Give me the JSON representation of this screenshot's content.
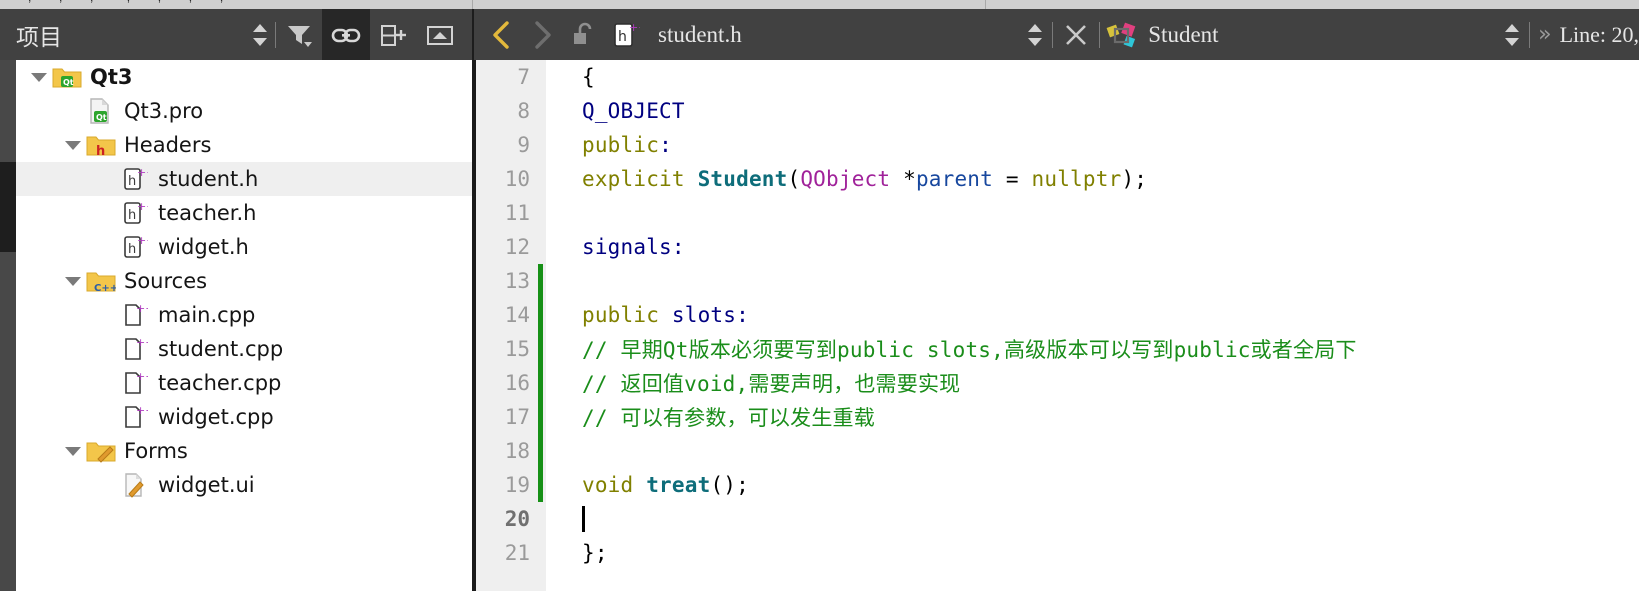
{
  "top_strip": {
    "ghost_text": "\\u25a0, \\u25a0, \\u25a0, \\u25a0, \\u25a0"
  },
  "toolbar": {
    "project_selector_label": "项目",
    "filter_icon": "filter-icon",
    "link_icon": "link-with-editor-icon",
    "split_add_icon": "split-add-icon",
    "collapse_icon": "collapse-icon",
    "back_icon": "navigate-back-icon",
    "forward_icon": "navigate-forward-icon",
    "lock_icon": "unlocked-padlock-icon",
    "file_type_icon": "cpp-header-file-icon",
    "open_file_name": "student.h",
    "close_icon": "close-document-icon",
    "symbol_icon": "qt-class-symbol-icon",
    "symbol_name": "Student",
    "overflow_icon": "overflow-chevrons-icon",
    "cursor_position": "Line: 20,"
  },
  "tree": {
    "items": [
      {
        "label": "Qt3",
        "icon": "qt-project-folder-icon",
        "depth": 0,
        "expanded": true,
        "bold": true,
        "selected": false
      },
      {
        "label": "Qt3.pro",
        "icon": "qt-pro-file-icon",
        "depth": 1,
        "expanded": null,
        "bold": false,
        "selected": false
      },
      {
        "label": "Headers",
        "icon": "headers-folder-icon",
        "depth": 1,
        "expanded": true,
        "bold": false,
        "selected": false
      },
      {
        "label": "student.h",
        "icon": "cpp-header-file-icon",
        "depth": 2,
        "expanded": null,
        "bold": false,
        "selected": true
      },
      {
        "label": "teacher.h",
        "icon": "cpp-header-file-icon",
        "depth": 2,
        "expanded": null,
        "bold": false,
        "selected": false
      },
      {
        "label": "widget.h",
        "icon": "cpp-header-file-icon",
        "depth": 2,
        "expanded": null,
        "bold": false,
        "selected": false
      },
      {
        "label": "Sources",
        "icon": "sources-folder-icon",
        "depth": 1,
        "expanded": true,
        "bold": false,
        "selected": false
      },
      {
        "label": "main.cpp",
        "icon": "cpp-source-file-icon",
        "depth": 2,
        "expanded": null,
        "bold": false,
        "selected": false
      },
      {
        "label": "student.cpp",
        "icon": "cpp-source-file-icon",
        "depth": 2,
        "expanded": null,
        "bold": false,
        "selected": false
      },
      {
        "label": "teacher.cpp",
        "icon": "cpp-source-file-icon",
        "depth": 2,
        "expanded": null,
        "bold": false,
        "selected": false
      },
      {
        "label": "widget.cpp",
        "icon": "cpp-source-file-icon",
        "depth": 2,
        "expanded": null,
        "bold": false,
        "selected": false
      },
      {
        "label": "Forms",
        "icon": "forms-folder-icon",
        "depth": 1,
        "expanded": true,
        "bold": false,
        "selected": false
      },
      {
        "label": "widget.ui",
        "icon": "ui-form-file-icon",
        "depth": 2,
        "expanded": null,
        "bold": false,
        "selected": false
      }
    ]
  },
  "editor": {
    "lines": [
      {
        "no": "7",
        "changed": false,
        "current": false,
        "tokens": [
          {
            "t": "{",
            "c": "plain"
          }
        ]
      },
      {
        "no": "8",
        "changed": false,
        "current": false,
        "tokens": [
          {
            "t": "    ",
            "c": "plain"
          },
          {
            "t": "Q_OBJECT",
            "c": "macro"
          }
        ]
      },
      {
        "no": "9",
        "changed": false,
        "current": false,
        "tokens": [
          {
            "t": "public",
            "c": "kw"
          },
          {
            "t": ":",
            "c": "navy"
          }
        ]
      },
      {
        "no": "10",
        "changed": false,
        "current": false,
        "tokens": [
          {
            "t": "    ",
            "c": "plain"
          },
          {
            "t": "explicit ",
            "c": "kw"
          },
          {
            "t": "Student",
            "c": "type"
          },
          {
            "t": "(",
            "c": "plain"
          },
          {
            "t": "QObject ",
            "c": "cls"
          },
          {
            "t": "*",
            "c": "plain"
          },
          {
            "t": "parent",
            "c": "var"
          },
          {
            "t": " = ",
            "c": "plain"
          },
          {
            "t": "nullptr",
            "c": "kw"
          },
          {
            "t": ");",
            "c": "plain"
          }
        ]
      },
      {
        "no": "11",
        "changed": false,
        "current": false,
        "tokens": []
      },
      {
        "no": "12",
        "changed": false,
        "current": false,
        "tokens": [
          {
            "t": "signals:",
            "c": "navy"
          }
        ]
      },
      {
        "no": "13",
        "changed": true,
        "current": false,
        "tokens": []
      },
      {
        "no": "14",
        "changed": true,
        "current": false,
        "tokens": [
          {
            "t": "public",
            "c": "kw"
          },
          {
            "t": " slots:",
            "c": "navy"
          }
        ]
      },
      {
        "no": "15",
        "changed": true,
        "current": false,
        "tokens": [
          {
            "t": "    ",
            "c": "plain"
          },
          {
            "t": "// 早期Qt版本必须要写到public slots,高级版本可以写到public或者全局下",
            "c": "cmt"
          }
        ]
      },
      {
        "no": "16",
        "changed": true,
        "current": false,
        "tokens": [
          {
            "t": "    ",
            "c": "plain"
          },
          {
            "t": "// 返回值void,需要声明，也需要实现",
            "c": "cmt"
          }
        ]
      },
      {
        "no": "17",
        "changed": true,
        "current": false,
        "tokens": [
          {
            "t": "    ",
            "c": "plain"
          },
          {
            "t": "// 可以有参数，可以发生重载",
            "c": "cmt"
          }
        ]
      },
      {
        "no": "18",
        "changed": true,
        "current": false,
        "tokens": []
      },
      {
        "no": "19",
        "changed": true,
        "current": false,
        "tokens": [
          {
            "t": "    ",
            "c": "plain"
          },
          {
            "t": "void ",
            "c": "kw"
          },
          {
            "t": "treat",
            "c": "type"
          },
          {
            "t": "();",
            "c": "plain"
          }
        ]
      },
      {
        "no": "20",
        "changed": false,
        "current": true,
        "tokens": []
      },
      {
        "no": "21",
        "changed": false,
        "current": false,
        "tokens": [
          {
            "t": "};",
            "c": "plain"
          }
        ]
      }
    ]
  },
  "colors": {
    "toolbar_bg": "#414141",
    "editor_bg": "#ffffff",
    "gutter_bg": "#efefef",
    "selection_bg": "#efefef",
    "change_bar": "#169016",
    "comment": "#1a8d1a",
    "keyword": "#808000",
    "macro": "#000080",
    "type": "#0e6d7a",
    "class": "#a0229a"
  }
}
